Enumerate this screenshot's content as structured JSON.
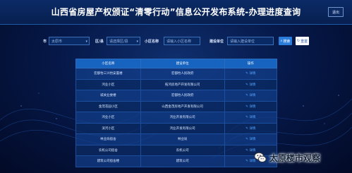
{
  "header": {
    "title": "山西省房屋产权颁证“清零行动”信息公开发布系统-办理进度查询",
    "logout_label": "退出"
  },
  "search": {
    "city_label": "市",
    "city_value": "太原市",
    "district_label": "区/县",
    "district_placeholder": "请选择区/县",
    "community_label": "小区名称",
    "community_placeholder": "请输入小区名称",
    "developer_label": "建设单位",
    "developer_placeholder": "请输入建设单位",
    "search_label": "搜索",
    "reset_label": "重置"
  },
  "table": {
    "headers": [
      "小区名称",
      "建设单位",
      "操作"
    ],
    "rows": [
      {
        "name": "宏都怡三兴怡安置楼",
        "unit": "宏都怡人民政府",
        "action": "详情"
      },
      {
        "name": "鸿业小区",
        "unit": "拓鸿房地产开发有限公司",
        "action": "详情"
      },
      {
        "name": "城关业委楼",
        "unit": "宏都怡人民政府",
        "action": "详情"
      },
      {
        "name": "金茂花园小区",
        "unit": "山西金茂房地产开发有限公司",
        "action": "详情"
      },
      {
        "name": "鸿业小区",
        "unit": "鸿业开发有限公司",
        "action": "详情"
      },
      {
        "name": "滨河小区",
        "unit": "鸿业开发有限公司",
        "action": "详情"
      },
      {
        "name": "林业局宿舍",
        "unit": "林业局",
        "action": "详情"
      },
      {
        "name": "农机公司宿舍",
        "unit": "农机公司",
        "action": "详情"
      },
      {
        "name": "建筑公司宿舍楼",
        "unit": "建筑公司",
        "action": "详情"
      }
    ]
  },
  "watermark": {
    "text": "太原楼市观察"
  },
  "colors": {
    "accent": "#2b7bd9",
    "header_row": "#1764c0",
    "link": "#58a6ff"
  }
}
